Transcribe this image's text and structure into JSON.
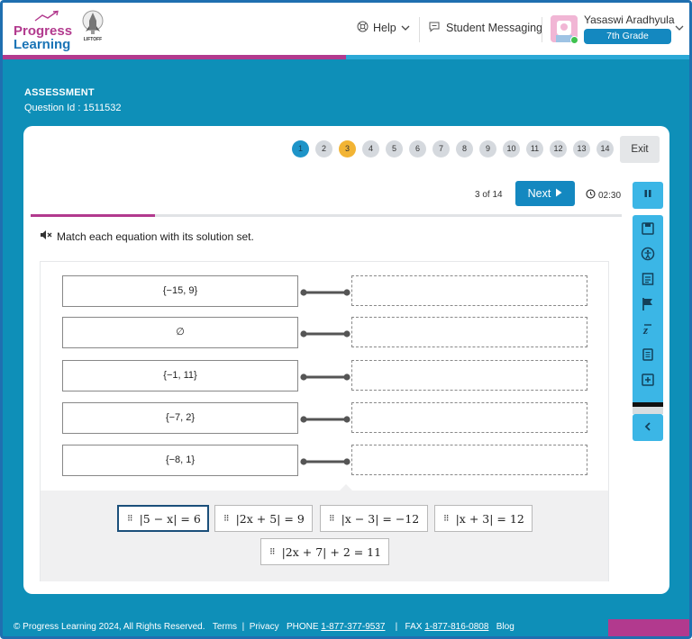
{
  "header": {
    "logo_line1": "Progress",
    "logo_line2": "Learning",
    "liftoff_label": "LIFTOFF",
    "help_label": "Help",
    "messaging_label": "Student Messaging",
    "user_name": "Yasaswi Aradhyula",
    "grade": "7th Grade",
    "overall_progress": 0.5
  },
  "assessment": {
    "title": "ASSESSMENT",
    "question_id": "Question Id : 1511532"
  },
  "pager": {
    "pages": [
      "1",
      "2",
      "3",
      "4",
      "5",
      "6",
      "7",
      "8",
      "9",
      "10",
      "11",
      "12",
      "13",
      "14"
    ],
    "active_page": "1",
    "answered_page": "3",
    "exit_label": "Exit"
  },
  "question": {
    "counter": "3 of 14",
    "next_label": "Next",
    "timer": "02:30",
    "prompt": "Match each equation with its solution set.",
    "progress": 0.21,
    "solution_sets": [
      "{−15, 9}",
      "∅",
      "{−1, 11}",
      "{−7, 2}",
      "{−8, 1}"
    ],
    "answer_bank": [
      "|5 − x| = 6",
      "|2x + 5| = 9",
      "|x − 3| = −12",
      "|x + 3| = 12",
      "|2x + 7| + 2 = 11"
    ],
    "selected_answer": "|5 − x| = 6"
  },
  "tools": [
    "save-icon",
    "accessibility-icon",
    "reference-sheet-icon",
    "flag-icon",
    "translate-icon",
    "notepad-icon",
    "notes-icon"
  ],
  "colors": {
    "brand_blue": "#1488c0",
    "brand_magenta": "#b23a8e",
    "background": "#0e8fb8",
    "answered": "#f2b434"
  },
  "footer": {
    "copyright": "© Progress Learning 2024, All Rights Reserved.",
    "terms": "Terms",
    "sep1": "|",
    "privacy": "Privacy",
    "phone_label": "PHONE",
    "phone": "1-877-377-9537",
    "sep2": "|",
    "fax_label": "FAX",
    "fax": "1-877-816-0808",
    "blog": "Blog"
  }
}
